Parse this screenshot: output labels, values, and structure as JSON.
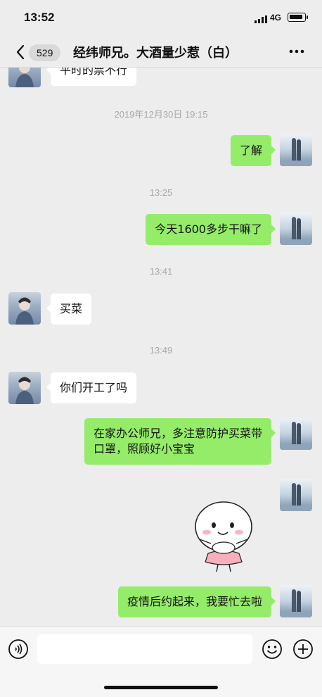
{
  "status_bar": {
    "time": "13:52",
    "network": "4G"
  },
  "header": {
    "unread_count": "529",
    "title": "经纬师兄。大酒量少惹（白）"
  },
  "messages": [
    {
      "id": 0,
      "side": "left",
      "text": "平时的票不行"
    },
    {
      "id": 1,
      "side": "right",
      "text": "了解"
    },
    {
      "id": 2,
      "side": "right",
      "text": "今天1600多步干嘛了"
    },
    {
      "id": 3,
      "side": "left",
      "text": "买菜"
    },
    {
      "id": 4,
      "side": "left",
      "text": "你们开工了吗"
    },
    {
      "id": 5,
      "side": "right",
      "text": "在家办公师兄，多注意防护买菜带",
      "text2": "口罩，照顾好小宝宝"
    },
    {
      "id": 6,
      "side": "right",
      "type": "sticker",
      "sticker": "smiling-dumpling-ballerina"
    },
    {
      "id": 7,
      "side": "right",
      "text": "疫情后约起来，我要忙去啦"
    }
  ],
  "timestamps": [
    "2019年12月30日 19:15",
    "13:25",
    "13:41",
    "13:49"
  ],
  "input_bar": {
    "voice_icon": "voice-icon",
    "emoji_icon": "emoji-icon",
    "plus_icon": "plus-icon",
    "placeholder": ""
  },
  "icons": {
    "back": "chevron-left-icon",
    "more": "more-dots-icon"
  },
  "colors": {
    "bubble_self": "#95ec69",
    "bubble_other": "#ffffff",
    "background": "#ededed"
  }
}
